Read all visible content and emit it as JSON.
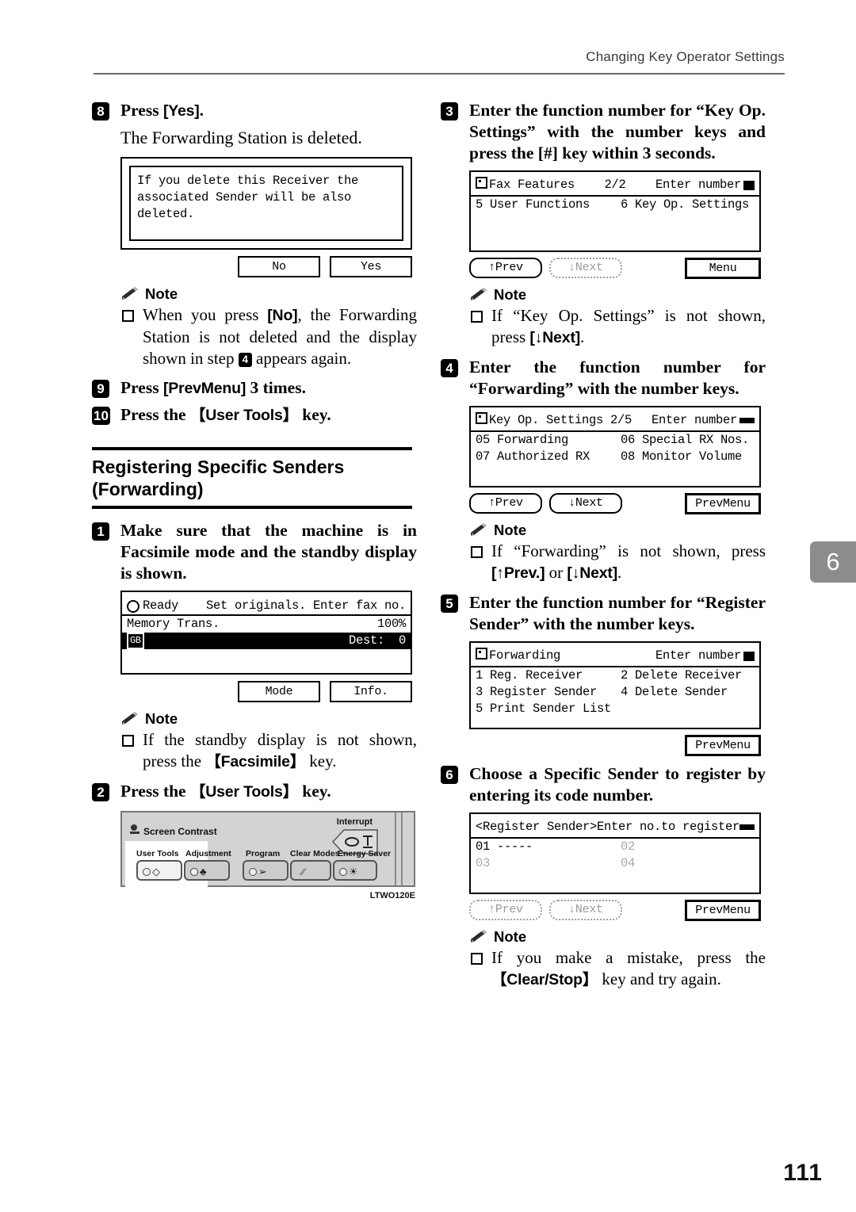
{
  "header": {
    "title": "Changing Key Operator Settings"
  },
  "chapter_tab": {
    "number": "6"
  },
  "page_number": "111",
  "figure_code": "LTWO120E",
  "note_label": "Note",
  "left_column": {
    "step8": {
      "num": "8",
      "text_before": "Press ",
      "key": "[Yes]",
      "text_after": ".",
      "body": "The Forwarding Station is deleted."
    },
    "dialog": {
      "lines": [
        "If you delete this Receiver the",
        "associated Sender will be also",
        "deleted."
      ],
      "buttons": [
        "No",
        "Yes"
      ]
    },
    "note1": {
      "part1": "When you press ",
      "key": "[No]",
      "part2": ", the Forwarding Station is not deleted and the display shown in step ",
      "step_ref": "4",
      "part3": " appears again."
    },
    "step9": {
      "num": "9",
      "text_before": "Press ",
      "key": "[PrevMenu]",
      "text_after": " 3 times."
    },
    "step10": {
      "num": "10",
      "text_before": "Press the ",
      "key": "【User Tools】",
      "text_after": " key."
    },
    "section": {
      "line1": "Registering Specific Senders",
      "line2": "(Forwarding)"
    },
    "step1": {
      "num": "1",
      "text": "Make sure that the machine is in Facsimile mode and the standby display is shown."
    },
    "standby_lcd": {
      "status": "Ready",
      "prompt": "Set originals. Enter fax no.",
      "row2_left": "Memory Trans.",
      "row2_right": "100%",
      "row3_left": "GB",
      "row3_right_label": "Dest:",
      "row3_right_value": "0",
      "buttons": [
        "Mode",
        "Info."
      ]
    },
    "note2": {
      "part1": "If the standby display is not shown, press the ",
      "key": "【Facsimile】",
      "part2": " key."
    },
    "step2": {
      "num": "2",
      "text_before": "Press the ",
      "key": "【User Tools】",
      "text_after": " key."
    },
    "panel": {
      "screen_contrast": "Screen Contrast",
      "interrupt": "Interrupt",
      "keys": [
        {
          "label": "User Tools"
        },
        {
          "label": "Adjustment"
        },
        {
          "label": "Program"
        },
        {
          "label": "Clear Modes"
        },
        {
          "label": "Energy Saver"
        }
      ]
    }
  },
  "right_column": {
    "step3": {
      "num": "3",
      "text": "Enter the function number for “Key Op. Settings” with the number keys and press the [#] key within 3 seconds."
    },
    "lcd3": {
      "title": "Fax Features",
      "page": "2/2",
      "prompt": "Enter number",
      "items": [
        "5 User Functions",
        "6 Key Op. Settings"
      ],
      "btn_prev": "↑Prev",
      "btn_next": "↓Next",
      "btn_menu": "Menu"
    },
    "note3": {
      "part1": "If “Key Op. Settings” is not shown, press ",
      "key": "[↓Next]",
      "part2": "."
    },
    "step4": {
      "num": "4",
      "text": "Enter the function number for “Forwarding” with the number keys."
    },
    "lcd4": {
      "title": "Key Op. Settings",
      "page": "2/5",
      "prompt": "Enter number",
      "rows": [
        [
          "05 Forwarding",
          "06 Special RX Nos."
        ],
        [
          "07 Authorized RX",
          "08 Monitor Volume"
        ]
      ],
      "btn_prev": "↑Prev",
      "btn_next": "↓Next",
      "btn_prevmenu": "PrevMenu"
    },
    "note4": {
      "part1": "If “Forwarding” is not shown, press ",
      "key1": "[↑Prev.]",
      "mid": " or ",
      "key2": "[↓Next]",
      "part2": "."
    },
    "step5": {
      "num": "5",
      "text": "Enter the function number for “Register Sender” with the number keys."
    },
    "lcd5": {
      "title": "Forwarding",
      "prompt": "Enter number",
      "rows": [
        [
          "1 Reg. Receiver",
          "2 Delete Receiver"
        ],
        [
          "3 Register Sender",
          "4 Delete Sender"
        ],
        [
          "5 Print Sender List",
          ""
        ]
      ],
      "btn_prevmenu": "PrevMenu"
    },
    "step6": {
      "num": "6",
      "text": "Choose a Specific Sender to register by entering its code number."
    },
    "lcd6": {
      "title": "<Register Sender>",
      "prompt": "Enter no.to register",
      "rows": [
        [
          "01 -----",
          "02"
        ],
        [
          "03",
          "04"
        ]
      ],
      "btn_prev": "↑Prev",
      "btn_next": "↓Next",
      "btn_prevmenu": "PrevMenu"
    },
    "note5": {
      "part1": "If you make a mistake, press the ",
      "key": "【Clear/Stop】",
      "part2": " key and try again."
    }
  }
}
